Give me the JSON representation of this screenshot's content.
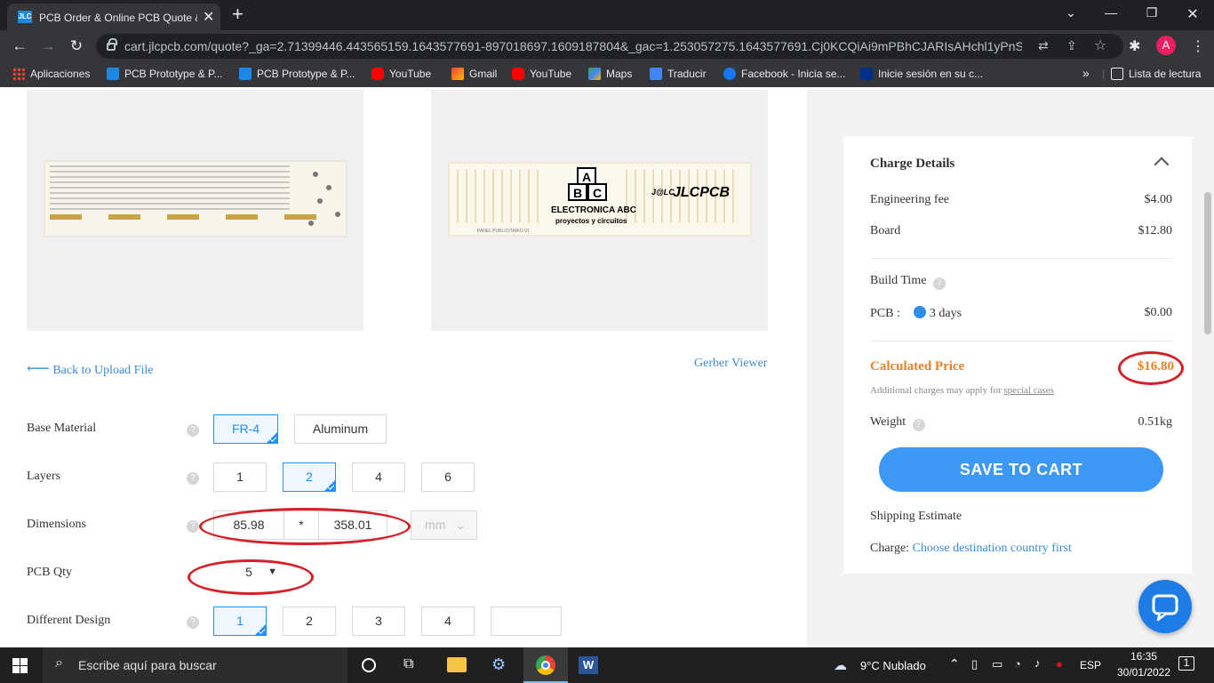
{
  "browser": {
    "tab_title": "PCB Order & Online PCB Quote & ...",
    "tab_favicon_text": "JLC",
    "url": "cart.jlcpcb.com/quote?_ga=2.71399446.443565159.1643577691-897018697.1609187804&_gac=1.253057275.1643577691.Cj0KCQiAi9mPBhCJARIsAHchl1yPnSXkZF...",
    "avatar_letter": "A",
    "bookmarks": [
      {
        "label": "Aplicaciones",
        "icon": "apps-grid-icon"
      },
      {
        "label": "PCB Prototype & P...",
        "icon": "jlc-icon"
      },
      {
        "label": "PCB Prototype & P...",
        "icon": "jlc-icon"
      },
      {
        "label": "YouTube",
        "icon": "youtube-icon"
      },
      {
        "label": "Gmail",
        "icon": "gmail-icon"
      },
      {
        "label": "YouTube",
        "icon": "youtube-icon"
      },
      {
        "label": "Maps",
        "icon": "maps-icon"
      },
      {
        "label": "Traducir",
        "icon": "translate-icon"
      },
      {
        "label": "Facebook - Inicia se...",
        "icon": "facebook-icon"
      },
      {
        "label": "Inicie sesión en su c...",
        "icon": "paypal-icon"
      }
    ],
    "reading_list": "Lista de lectura",
    "more_bookmarks": "»"
  },
  "preview": {
    "logo_text": "ELECTRONICA ABC",
    "logo_sub": "proyectos y circuitos",
    "blocks": [
      "A",
      "B",
      "C"
    ],
    "brand": "JLCPCB",
    "brand_badge": "J@LC",
    "silk_label": "PANEL PUBLICITARIO V1",
    "back_link": "Back to Upload File",
    "gerber_link": "Gerber Viewer"
  },
  "form": {
    "base_material": {
      "label": "Base Material",
      "options": [
        "FR-4",
        "Aluminum"
      ],
      "selected": "FR-4"
    },
    "layers": {
      "label": "Layers",
      "options": [
        "1",
        "2",
        "4",
        "6"
      ],
      "selected": "2"
    },
    "dimensions": {
      "label": "Dimensions",
      "width": "85.98",
      "sep": "*",
      "height": "358.01",
      "unit": "mm"
    },
    "pcb_qty": {
      "label": "PCB Qty",
      "value": "5"
    },
    "different_design": {
      "label": "Different Design",
      "options": [
        "1",
        "2",
        "3",
        "4"
      ],
      "selected": "1"
    }
  },
  "charge": {
    "title": "Charge Details",
    "engineering_fee_label": "Engineering fee",
    "engineering_fee": "$4.00",
    "board_label": "Board",
    "board": "$12.80",
    "build_time_label": "Build Time",
    "pcb_label": "PCB :",
    "pcb_days": "3 days",
    "pcb_price": "$0.00",
    "calculated_label": "Calculated Price",
    "calculated_price": "$16.80",
    "additional_note": "Additional charges may apply for",
    "special_cases": "special cases",
    "weight_label": "Weight",
    "weight": "0.51kg",
    "save_button": "SAVE TO CART",
    "shipping_label": "Shipping Estimate",
    "charge_label": "Charge:",
    "charge_link": "Choose destination country first",
    "accent": "#e8822a",
    "button_color": "#3c98f3"
  },
  "taskbar": {
    "search_placeholder": "Escribe aquí para buscar",
    "weather": "9°C  Nublado",
    "language": "ESP",
    "time": "16:35",
    "date": "30/01/2022",
    "notifications": "1"
  }
}
